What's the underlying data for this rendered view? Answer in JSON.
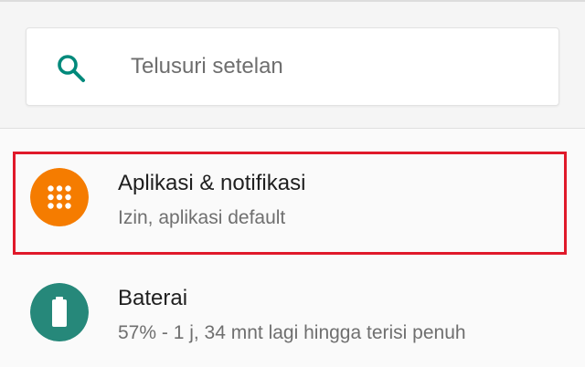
{
  "search": {
    "placeholder": "Telusuri setelan",
    "icon": "search-icon",
    "icon_color": "#00897b"
  },
  "settings_items": [
    {
      "title": "Aplikasi & notifikasi",
      "subtitle": "Izin, aplikasi default",
      "icon": "apps-grid-icon",
      "icon_color": "#f57c00",
      "highlighted": true,
      "highlight_color": "#e0192a"
    },
    {
      "title": "Baterai",
      "subtitle": "57% - 1 j, 34 mnt lagi hingga terisi penuh",
      "icon": "battery-icon",
      "icon_color": "#26887a"
    }
  ]
}
